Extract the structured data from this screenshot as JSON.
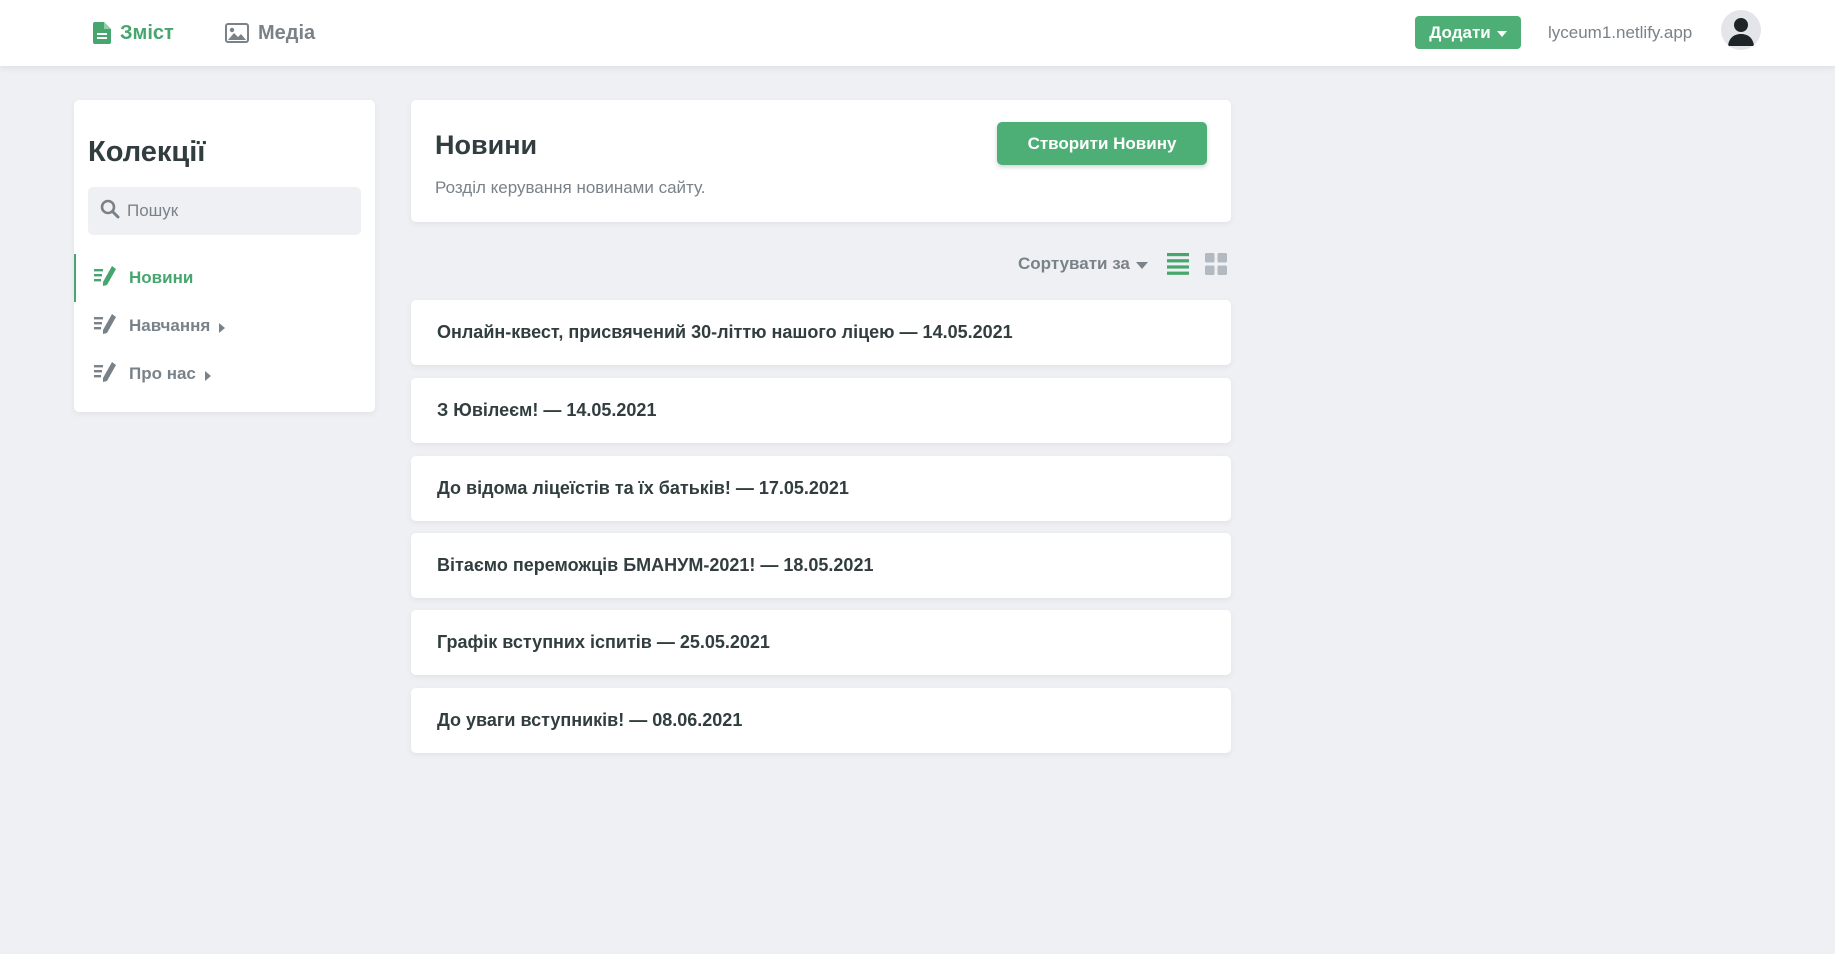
{
  "topbar": {
    "tabs": [
      {
        "label": "Зміст",
        "icon": "document-icon",
        "active": true
      },
      {
        "label": "Медіа",
        "icon": "image-icon",
        "active": false
      }
    ],
    "add_label": "Додати",
    "site_url": "lyceum1.netlify.app",
    "avatar_icon": "user-avatar-icon"
  },
  "sidebar": {
    "title": "Колекції",
    "search_placeholder": "Пошук",
    "items": [
      {
        "label": "Новини",
        "icon": "edit-list-icon",
        "active": true,
        "expandable": false
      },
      {
        "label": "Навчання",
        "icon": "edit-list-icon",
        "active": false,
        "expandable": true
      },
      {
        "label": "Про нас",
        "icon": "edit-list-icon",
        "active": false,
        "expandable": true
      }
    ]
  },
  "main": {
    "title": "Новини",
    "description": "Розділ керування новинами сайту.",
    "create_label": "Створити Новину",
    "sort_label": "Сортувати за",
    "view_modes": [
      "list-view-icon",
      "grid-view-icon"
    ],
    "active_view": "list",
    "entries": [
      "Онлайн-квест, присвячений 30-літтю нашого ліцею — 14.05.2021",
      "З Ювілеєм! — 14.05.2021",
      "До відома ліцеїстів та їх батьків! — 17.05.2021",
      "Вітаємо переможців БМАНУМ-2021! — 18.05.2021",
      "Графік вступних іспитів — 25.05.2021",
      "До уваги вступників! — 08.06.2021"
    ]
  },
  "colors": {
    "accent": "#46a66e",
    "button": "#4daf76",
    "background": "#eff0f4",
    "text": "#313d3e",
    "muted": "#7a8289"
  }
}
